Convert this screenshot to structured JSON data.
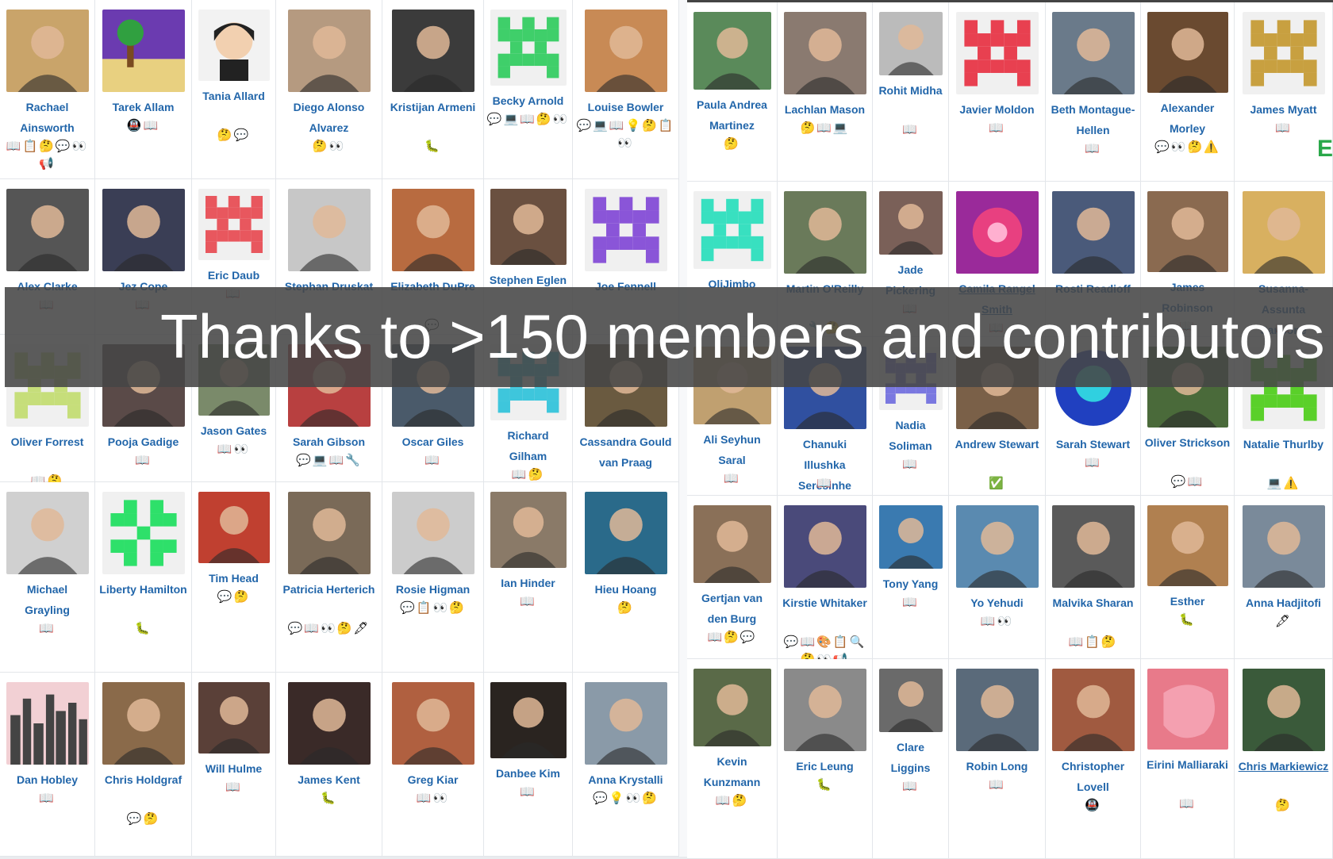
{
  "banner": {
    "text": "Thanks to >150 members and contributors"
  },
  "right_edge_glyph": "E",
  "left_panel": {
    "rows": [
      [
        {
          "name": "Rachael Ainsworth",
          "emojis": "📖📋🤔💬👀📢",
          "avatar": "photo",
          "bg": "#c9a46a"
        },
        {
          "name": "Tarek Allam",
          "emojis": "🚇📖",
          "avatar": "pixel-beach",
          "bg": "#6b3bb0"
        },
        {
          "name": "Tania Allard",
          "emojis": "🤔💬",
          "avatar": "cartoon",
          "bg": "#f2f2f2"
        },
        {
          "name": "Diego Alonso Alvarez",
          "emojis": "🤔👀",
          "avatar": "photo",
          "bg": "#b59a80"
        },
        {
          "name": "Kristijan Armeni",
          "emojis": "🐛",
          "avatar": "photo",
          "bg": "#3b3b3b"
        },
        {
          "name": "Becky Arnold",
          "emojis": "💬💻📖🤔👀",
          "avatar": "identicon",
          "bg": "#3fcf6a"
        },
        {
          "name": "Louise Bowler",
          "emojis": "💬💻📖💡🤔📋👀",
          "avatar": "photo",
          "bg": "#c88a55"
        }
      ],
      [
        {
          "name": "Alex Clarke",
          "emojis": "📖",
          "avatar": "photo",
          "bg": "#555"
        },
        {
          "name": "Jez Cope",
          "emojis": "📖",
          "avatar": "photo",
          "bg": "#3a3e55"
        },
        {
          "name": "Eric Daub",
          "emojis": "📖",
          "avatar": "identicon",
          "bg": "#e8575e"
        },
        {
          "name": "Stephan Druskat",
          "emojis": "",
          "avatar": "photo",
          "bg": "#c7c7c7"
        },
        {
          "name": "Elizabeth DuPre",
          "emojis": "💬",
          "avatar": "photo",
          "bg": "#b86b40"
        },
        {
          "name": "Stephen Eglen",
          "emojis": "",
          "avatar": "photo",
          "bg": "#6a5040"
        },
        {
          "name": "Joe Fennell",
          "emojis": "",
          "avatar": "identicon",
          "bg": "#8a55d8"
        }
      ],
      [
        {
          "name": "Oliver Forrest",
          "emojis": "📖🤔",
          "avatar": "identicon",
          "bg": "#c6de7a"
        },
        {
          "name": "Pooja Gadige",
          "emojis": "📖",
          "avatar": "photo",
          "bg": "#5a4a48"
        },
        {
          "name": "Jason Gates",
          "emojis": "📖👀",
          "avatar": "photo",
          "bg": "#7a8a6a"
        },
        {
          "name": "Sarah Gibson",
          "emojis": "💬💻📖🔧",
          "avatar": "photo",
          "bg": "#b84040"
        },
        {
          "name": "Oscar Giles",
          "emojis": "📖",
          "avatar": "photo",
          "bg": "#4a5a6a"
        },
        {
          "name": "Richard Gilham",
          "emojis": "📖🤔",
          "avatar": "identicon",
          "bg": "#3ec6dc"
        },
        {
          "name": "Cassandra Gould van Praag",
          "emojis": "",
          "avatar": "photo",
          "bg": "#6a5a40"
        }
      ],
      [
        {
          "name": "Michael Grayling",
          "emojis": "📖",
          "avatar": "photo",
          "bg": "#d0d0d0"
        },
        {
          "name": "Liberty Hamilton",
          "emojis": "🐛",
          "avatar": "identicon-star",
          "bg": "#2ee06a"
        },
        {
          "name": "Tim Head",
          "emojis": "💬🤔",
          "avatar": "photo",
          "bg": "#c04030"
        },
        {
          "name": "Patricia Herterich",
          "emojis": "💬📖👀🤔🖋",
          "avatar": "photo",
          "bg": "#7a6a58"
        },
        {
          "name": "Rosie Higman",
          "emojis": "💬📋👀🤔",
          "avatar": "photo",
          "bg": "#ccc"
        },
        {
          "name": "Ian Hinder",
          "emojis": "📖",
          "avatar": "photo",
          "bg": "#8a7a68"
        },
        {
          "name": "Hieu Hoang",
          "emojis": "🤔",
          "avatar": "photo",
          "bg": "#2a6a8a"
        }
      ],
      [
        {
          "name": "Dan Hobley",
          "emojis": "📖",
          "avatar": "city",
          "bg": "#d06070"
        },
        {
          "name": "Chris Holdgraf",
          "emojis": "💬🤔",
          "avatar": "photo",
          "bg": "#8a6a4a"
        },
        {
          "name": "Will Hulme",
          "emojis": "📖",
          "avatar": "photo",
          "bg": "#5a4038"
        },
        {
          "name": "James Kent",
          "emojis": "🐛",
          "avatar": "photo",
          "bg": "#3a2a28"
        },
        {
          "name": "Greg Kiar",
          "emojis": "📖👀",
          "avatar": "photo",
          "bg": "#b06040"
        },
        {
          "name": "Danbee Kim",
          "emojis": "📖",
          "avatar": "photo",
          "bg": "#2a2420"
        },
        {
          "name": "Anna Krystalli",
          "emojis": "💬💡👀🤔",
          "avatar": "photo",
          "bg": "#8a9aa8"
        }
      ]
    ]
  },
  "right_panel": {
    "rows": [
      [
        {
          "name": "Paula Andrea Martinez",
          "emojis": "🤔",
          "avatar": "photo",
          "bg": "#5a8a5a"
        },
        {
          "name": "Lachlan Mason",
          "emojis": "🤔📖💻",
          "avatar": "photo",
          "bg": "#8a7a70"
        },
        {
          "name": "Rohit Midha",
          "emojis": "📖",
          "avatar": "photo",
          "bg": "#bbb"
        },
        {
          "name": "Javier Moldon",
          "emojis": "📖",
          "avatar": "identicon",
          "bg": "#e84050"
        },
        {
          "name": "Beth Montague-Hellen",
          "emojis": "📖",
          "avatar": "photo",
          "bg": "#6a7a8a"
        },
        {
          "name": "Alexander Morley",
          "emojis": "💬👀🤔⚠️",
          "avatar": "photo",
          "bg": "#6a4a30"
        },
        {
          "name": "James Myatt",
          "emojis": "📖",
          "avatar": "identicon",
          "bg": "#c8a040"
        }
      ],
      [
        {
          "name": "OliJimbo",
          "emojis": "",
          "avatar": "identicon",
          "bg": "#38e0c0"
        },
        {
          "name": "Martin O'Reilly",
          "emojis": "🔧🤔",
          "avatar": "photo",
          "bg": "#6a7a5a"
        },
        {
          "name": "Jade Pickering",
          "emojis": "📖",
          "avatar": "photo",
          "bg": "#7a6058"
        },
        {
          "name": "Camila Rangel Smith",
          "emojis": "📖",
          "avatar": "burst",
          "bg": "#9a2a9a",
          "link": true
        },
        {
          "name": "Rosti Readioff",
          "emojis": "",
          "avatar": "photo",
          "bg": "#4a5a7a"
        },
        {
          "name": "James Robinson",
          "emojis": "📖",
          "avatar": "photo",
          "bg": "#8a6a50"
        },
        {
          "name": "Susanna-Assunta Sansone",
          "emojis": "📖",
          "avatar": "photo",
          "bg": "#d8b060"
        }
      ],
      [
        {
          "name": "Ali Seyhun Saral",
          "emojis": "📖",
          "avatar": "photo",
          "bg": "#c0a070"
        },
        {
          "name": "Chanuki Illushka Seresinhe",
          "emojis": "📖",
          "avatar": "photo",
          "bg": "#3050a0"
        },
        {
          "name": "Nadia Soliman",
          "emojis": "📖",
          "avatar": "identicon",
          "bg": "#7a78e0"
        },
        {
          "name": "Andrew Stewart",
          "emojis": "✅",
          "avatar": "photo",
          "bg": "#7a6048"
        },
        {
          "name": "Sarah Stewart",
          "emojis": "📖",
          "avatar": "neon",
          "bg": "#2040c0"
        },
        {
          "name": "Oliver Strickson",
          "emojis": "💬📖",
          "avatar": "photo",
          "bg": "#4a6a3a"
        },
        {
          "name": "Natalie Thurlby",
          "emojis": "💻⚠️",
          "avatar": "identicon",
          "bg": "#5ad02a"
        }
      ],
      [
        {
          "name": "Gertjan van den Burg",
          "emojis": "📖🤔💬",
          "avatar": "photo",
          "bg": "#8a7058"
        },
        {
          "name": "Kirstie Whitaker",
          "emojis": "💬📖🎨📋🔍🤔👀📢",
          "avatar": "photo",
          "bg": "#4a4a7a"
        },
        {
          "name": "Tony Yang",
          "emojis": "📖",
          "avatar": "photo",
          "bg": "#3a7ab0"
        },
        {
          "name": "Yo Yehudi",
          "emojis": "📖👀",
          "avatar": "photo",
          "bg": "#5a8ab0"
        },
        {
          "name": "Malvika Sharan",
          "emojis": "📖📋🤔",
          "avatar": "photo",
          "bg": "#5a5a5a"
        },
        {
          "name": "Esther",
          "emojis": "🐛",
          "avatar": "photo",
          "bg": "#b08050"
        },
        {
          "name": "Anna Hadjitofi",
          "emojis": "🖋",
          "avatar": "photo",
          "bg": "#7a8a9a"
        }
      ],
      [
        {
          "name": "Kevin Kunzmann",
          "emojis": "📖🤔",
          "avatar": "photo",
          "bg": "#5a6a48"
        },
        {
          "name": "Eric Leung",
          "emojis": "🐛",
          "avatar": "photo",
          "bg": "#8a8a8a"
        },
        {
          "name": "Clare Liggins",
          "emojis": "📖",
          "avatar": "photo",
          "bg": "#6a6a6a"
        },
        {
          "name": "Robin Long",
          "emojis": "📖",
          "avatar": "photo",
          "bg": "#5a6a7a"
        },
        {
          "name": "Christopher Lovell",
          "emojis": "🚇",
          "avatar": "photo",
          "bg": "#a05a40"
        },
        {
          "name": "Eirini Malliaraki",
          "emojis": "📖",
          "avatar": "blob",
          "bg": "#e87a8a"
        },
        {
          "name": "Chris Markiewicz",
          "emojis": "🤔",
          "avatar": "photo",
          "bg": "#3a5a3a",
          "link": true
        }
      ]
    ]
  }
}
